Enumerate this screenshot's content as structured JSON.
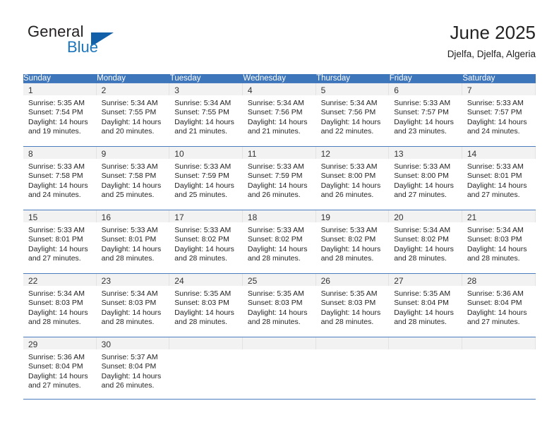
{
  "brand": {
    "name_top": "General",
    "name_bottom": "Blue",
    "accent_color": "#1160a8",
    "text_color": "#221f1f"
  },
  "header": {
    "title": "June 2025",
    "subtitle": "Djelfa, Djelfa, Algeria"
  },
  "theme": {
    "header_blue": "#3d76bb",
    "row_divider": "#4a7cbf",
    "daynum_band": "#f2f2f2"
  },
  "calendar": {
    "weekday_headers": [
      "Sunday",
      "Monday",
      "Tuesday",
      "Wednesday",
      "Thursday",
      "Friday",
      "Saturday"
    ],
    "weeks": [
      [
        {
          "day": "1",
          "sunrise": "Sunrise: 5:35 AM",
          "sunset": "Sunset: 7:54 PM",
          "daylight1": "Daylight: 14 hours",
          "daylight2": "and 19 minutes."
        },
        {
          "day": "2",
          "sunrise": "Sunrise: 5:34 AM",
          "sunset": "Sunset: 7:55 PM",
          "daylight1": "Daylight: 14 hours",
          "daylight2": "and 20 minutes."
        },
        {
          "day": "3",
          "sunrise": "Sunrise: 5:34 AM",
          "sunset": "Sunset: 7:55 PM",
          "daylight1": "Daylight: 14 hours",
          "daylight2": "and 21 minutes."
        },
        {
          "day": "4",
          "sunrise": "Sunrise: 5:34 AM",
          "sunset": "Sunset: 7:56 PM",
          "daylight1": "Daylight: 14 hours",
          "daylight2": "and 21 minutes."
        },
        {
          "day": "5",
          "sunrise": "Sunrise: 5:34 AM",
          "sunset": "Sunset: 7:56 PM",
          "daylight1": "Daylight: 14 hours",
          "daylight2": "and 22 minutes."
        },
        {
          "day": "6",
          "sunrise": "Sunrise: 5:33 AM",
          "sunset": "Sunset: 7:57 PM",
          "daylight1": "Daylight: 14 hours",
          "daylight2": "and 23 minutes."
        },
        {
          "day": "7",
          "sunrise": "Sunrise: 5:33 AM",
          "sunset": "Sunset: 7:57 PM",
          "daylight1": "Daylight: 14 hours",
          "daylight2": "and 24 minutes."
        }
      ],
      [
        {
          "day": "8",
          "sunrise": "Sunrise: 5:33 AM",
          "sunset": "Sunset: 7:58 PM",
          "daylight1": "Daylight: 14 hours",
          "daylight2": "and 24 minutes."
        },
        {
          "day": "9",
          "sunrise": "Sunrise: 5:33 AM",
          "sunset": "Sunset: 7:58 PM",
          "daylight1": "Daylight: 14 hours",
          "daylight2": "and 25 minutes."
        },
        {
          "day": "10",
          "sunrise": "Sunrise: 5:33 AM",
          "sunset": "Sunset: 7:59 PM",
          "daylight1": "Daylight: 14 hours",
          "daylight2": "and 25 minutes."
        },
        {
          "day": "11",
          "sunrise": "Sunrise: 5:33 AM",
          "sunset": "Sunset: 7:59 PM",
          "daylight1": "Daylight: 14 hours",
          "daylight2": "and 26 minutes."
        },
        {
          "day": "12",
          "sunrise": "Sunrise: 5:33 AM",
          "sunset": "Sunset: 8:00 PM",
          "daylight1": "Daylight: 14 hours",
          "daylight2": "and 26 minutes."
        },
        {
          "day": "13",
          "sunrise": "Sunrise: 5:33 AM",
          "sunset": "Sunset: 8:00 PM",
          "daylight1": "Daylight: 14 hours",
          "daylight2": "and 27 minutes."
        },
        {
          "day": "14",
          "sunrise": "Sunrise: 5:33 AM",
          "sunset": "Sunset: 8:01 PM",
          "daylight1": "Daylight: 14 hours",
          "daylight2": "and 27 minutes."
        }
      ],
      [
        {
          "day": "15",
          "sunrise": "Sunrise: 5:33 AM",
          "sunset": "Sunset: 8:01 PM",
          "daylight1": "Daylight: 14 hours",
          "daylight2": "and 27 minutes."
        },
        {
          "day": "16",
          "sunrise": "Sunrise: 5:33 AM",
          "sunset": "Sunset: 8:01 PM",
          "daylight1": "Daylight: 14 hours",
          "daylight2": "and 28 minutes."
        },
        {
          "day": "17",
          "sunrise": "Sunrise: 5:33 AM",
          "sunset": "Sunset: 8:02 PM",
          "daylight1": "Daylight: 14 hours",
          "daylight2": "and 28 minutes."
        },
        {
          "day": "18",
          "sunrise": "Sunrise: 5:33 AM",
          "sunset": "Sunset: 8:02 PM",
          "daylight1": "Daylight: 14 hours",
          "daylight2": "and 28 minutes."
        },
        {
          "day": "19",
          "sunrise": "Sunrise: 5:33 AM",
          "sunset": "Sunset: 8:02 PM",
          "daylight1": "Daylight: 14 hours",
          "daylight2": "and 28 minutes."
        },
        {
          "day": "20",
          "sunrise": "Sunrise: 5:34 AM",
          "sunset": "Sunset: 8:02 PM",
          "daylight1": "Daylight: 14 hours",
          "daylight2": "and 28 minutes."
        },
        {
          "day": "21",
          "sunrise": "Sunrise: 5:34 AM",
          "sunset": "Sunset: 8:03 PM",
          "daylight1": "Daylight: 14 hours",
          "daylight2": "and 28 minutes."
        }
      ],
      [
        {
          "day": "22",
          "sunrise": "Sunrise: 5:34 AM",
          "sunset": "Sunset: 8:03 PM",
          "daylight1": "Daylight: 14 hours",
          "daylight2": "and 28 minutes."
        },
        {
          "day": "23",
          "sunrise": "Sunrise: 5:34 AM",
          "sunset": "Sunset: 8:03 PM",
          "daylight1": "Daylight: 14 hours",
          "daylight2": "and 28 minutes."
        },
        {
          "day": "24",
          "sunrise": "Sunrise: 5:35 AM",
          "sunset": "Sunset: 8:03 PM",
          "daylight1": "Daylight: 14 hours",
          "daylight2": "and 28 minutes."
        },
        {
          "day": "25",
          "sunrise": "Sunrise: 5:35 AM",
          "sunset": "Sunset: 8:03 PM",
          "daylight1": "Daylight: 14 hours",
          "daylight2": "and 28 minutes."
        },
        {
          "day": "26",
          "sunrise": "Sunrise: 5:35 AM",
          "sunset": "Sunset: 8:03 PM",
          "daylight1": "Daylight: 14 hours",
          "daylight2": "and 28 minutes."
        },
        {
          "day": "27",
          "sunrise": "Sunrise: 5:35 AM",
          "sunset": "Sunset: 8:04 PM",
          "daylight1": "Daylight: 14 hours",
          "daylight2": "and 28 minutes."
        },
        {
          "day": "28",
          "sunrise": "Sunrise: 5:36 AM",
          "sunset": "Sunset: 8:04 PM",
          "daylight1": "Daylight: 14 hours",
          "daylight2": "and 27 minutes."
        }
      ],
      [
        {
          "day": "29",
          "sunrise": "Sunrise: 5:36 AM",
          "sunset": "Sunset: 8:04 PM",
          "daylight1": "Daylight: 14 hours",
          "daylight2": "and 27 minutes."
        },
        {
          "day": "30",
          "sunrise": "Sunrise: 5:37 AM",
          "sunset": "Sunset: 8:04 PM",
          "daylight1": "Daylight: 14 hours",
          "daylight2": "and 26 minutes."
        },
        {
          "day": "",
          "sunrise": "",
          "sunset": "",
          "daylight1": "",
          "daylight2": ""
        },
        {
          "day": "",
          "sunrise": "",
          "sunset": "",
          "daylight1": "",
          "daylight2": ""
        },
        {
          "day": "",
          "sunrise": "",
          "sunset": "",
          "daylight1": "",
          "daylight2": ""
        },
        {
          "day": "",
          "sunrise": "",
          "sunset": "",
          "daylight1": "",
          "daylight2": ""
        },
        {
          "day": "",
          "sunrise": "",
          "sunset": "",
          "daylight1": "",
          "daylight2": ""
        }
      ]
    ]
  }
}
